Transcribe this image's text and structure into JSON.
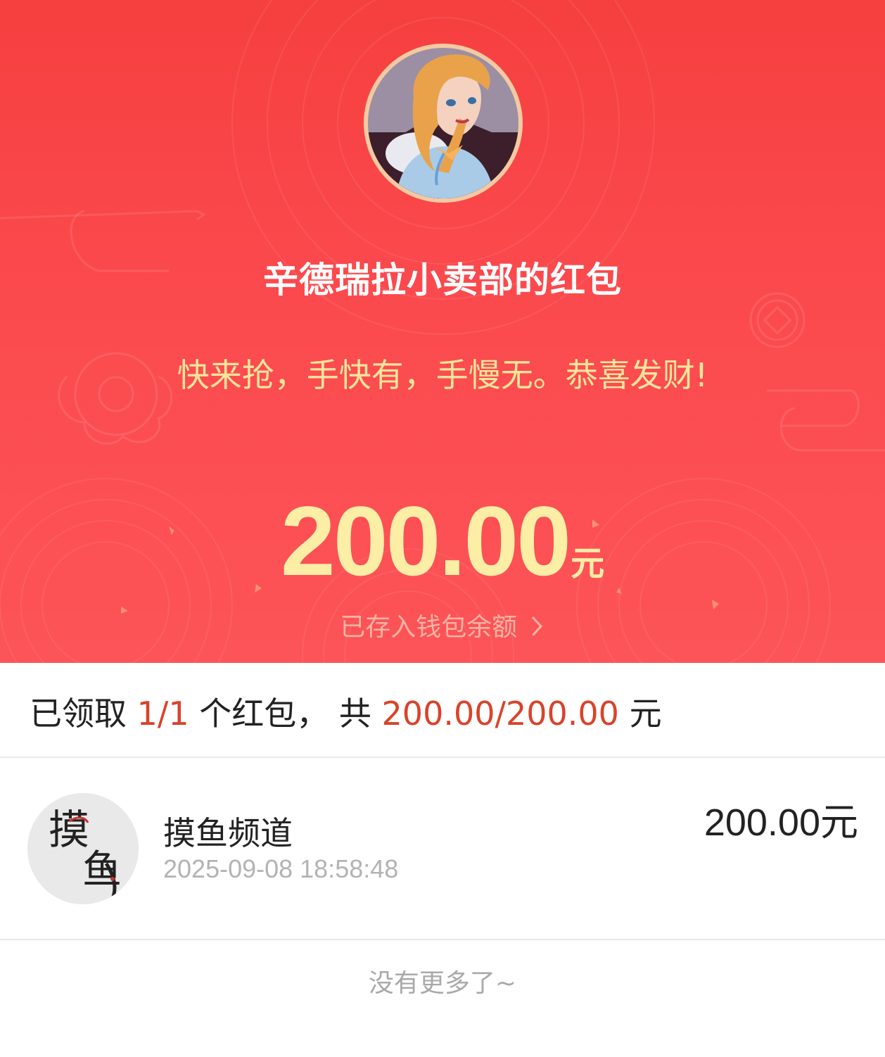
{
  "red_packet": {
    "sender_title": "辛德瑞拉小卖部的红包",
    "greeting": "快来抢，手快有，手慢无。恭喜发财!",
    "amount": "200.00",
    "amount_unit": "元",
    "wallet_link": "已存入钱包余额",
    "chevron_icon": "chevron-right-icon"
  },
  "summary": {
    "prefix": "已领取 ",
    "count": "1/1",
    "middle": " 个红包， 共 ",
    "total": "200.00/200.00",
    "suffix": " 元"
  },
  "receivers": [
    {
      "name": "摸鱼频道",
      "time": "2025-09-08 18:58:48",
      "amount": "200.00元",
      "avatar_text": "摸鱼"
    }
  ],
  "footer": {
    "no_more": "没有更多了~"
  },
  "colors": {
    "hero_red": "#f63f3f",
    "gold": "#fdeea6",
    "highlight": "#d94329"
  }
}
